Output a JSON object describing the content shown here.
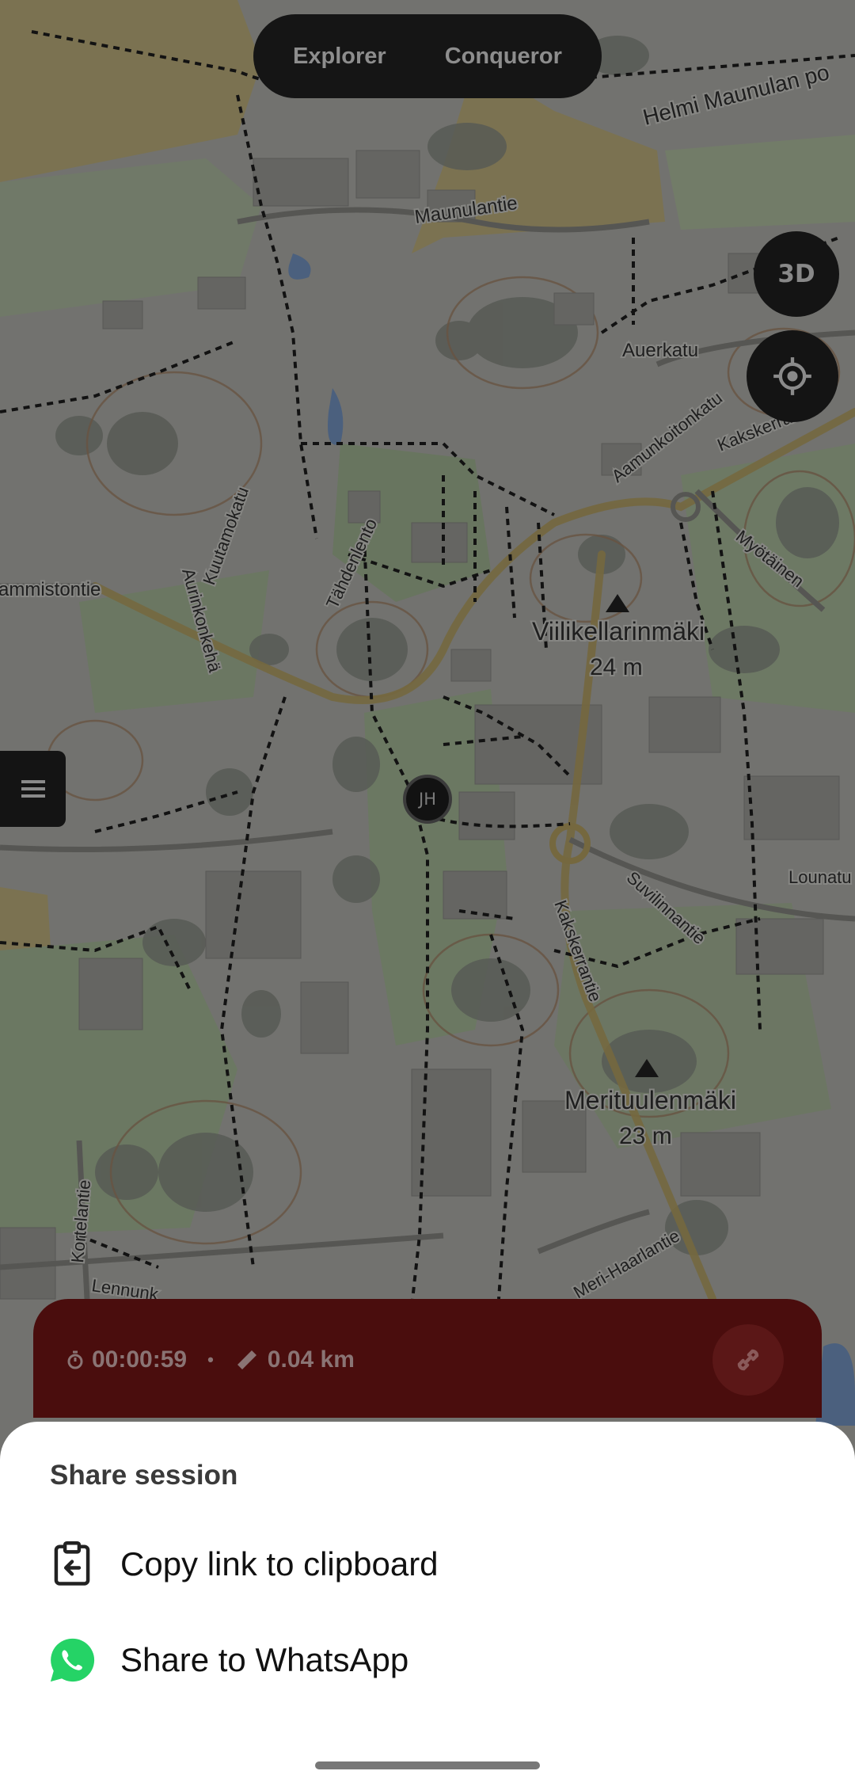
{
  "map": {
    "labels": [
      "Helmi Maunulan po",
      "Maunulantie",
      "Auerkatu",
      "Aamunkoitonkatu",
      "Kakskerrantie",
      "Aurinkonkehä",
      "Kuutamokatu",
      "Tähdenlento",
      "Myötäinen",
      "ammistontie",
      "Viilikellarinmäki",
      "24 m",
      "Suvilinnantie",
      "Lounatu",
      "Kakskerrantie",
      "Merituulenmäki",
      "23 m",
      "Kortelantie",
      "Lennunk",
      "Meri-Haarlantie"
    ]
  },
  "mode_toggle": {
    "explorer_label": "Explorer",
    "conqueror_label": "Conqueror"
  },
  "controls": {
    "three_d_label": "3D",
    "locate_icon": "crosshair-icon",
    "menu_icon": "hamburger-icon"
  },
  "player": {
    "initials": "JH"
  },
  "session": {
    "timer_icon": "stopwatch-icon",
    "elapsed": "00:00:59",
    "separator": "•",
    "distance_icon": "ruler-icon",
    "distance": "0.04 km",
    "link_icon": "link-icon"
  },
  "share_sheet": {
    "title": "Share session",
    "options": [
      {
        "label": "Copy link to clipboard",
        "icon": "clipboard-icon"
      },
      {
        "label": "Share to WhatsApp",
        "icon": "whatsapp-icon",
        "color": "#25D366"
      }
    ]
  },
  "colors": {
    "session_bar": "#4a0d0d",
    "sheet_background": "#ffffff",
    "map_overlay": "rgba(0,0,0,0.38)"
  }
}
